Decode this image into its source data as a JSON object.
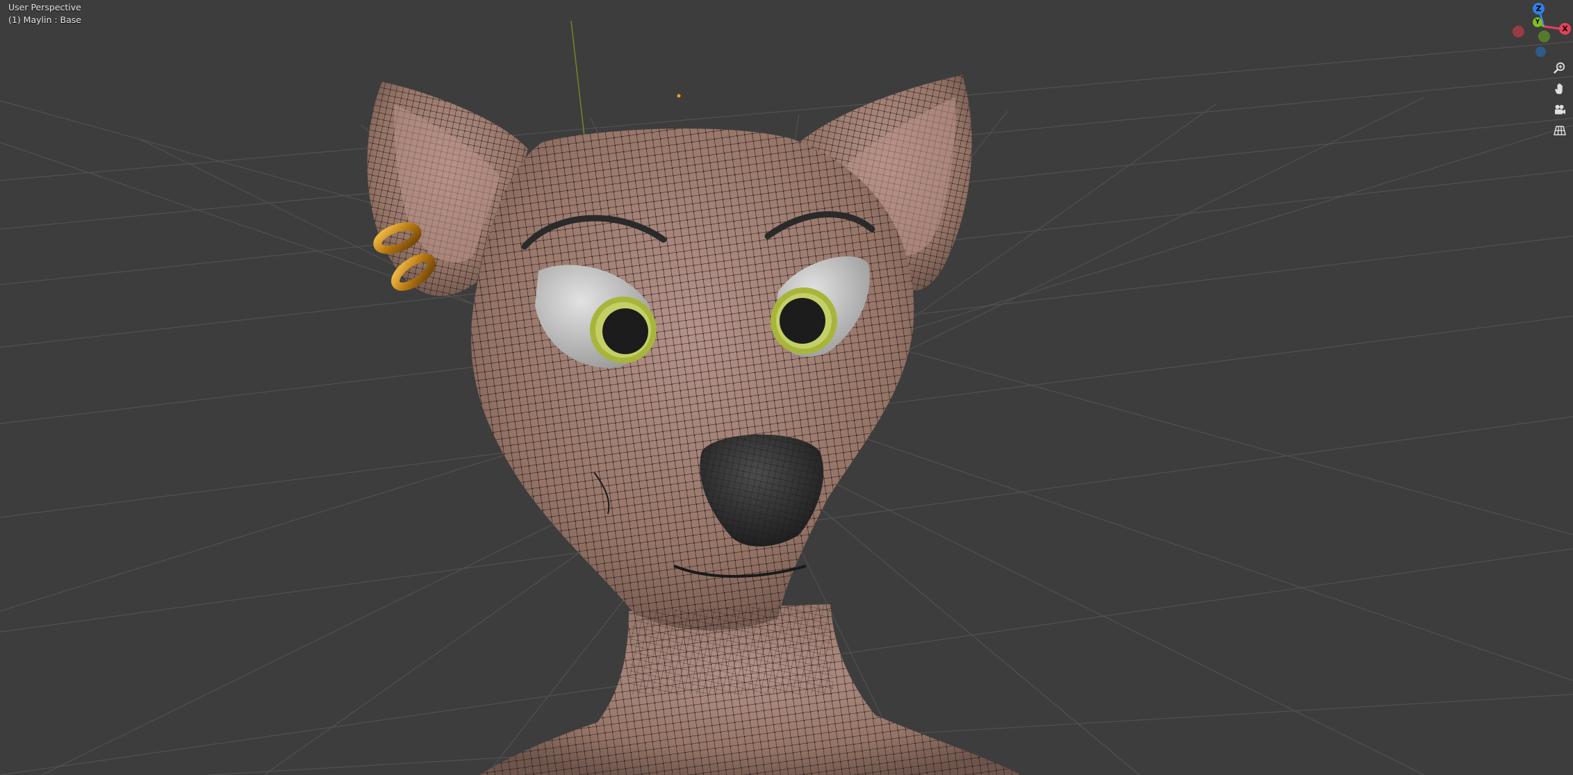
{
  "viewport": {
    "title": "User Perspective",
    "object_label": "(1) Maylin : Base"
  },
  "gizmo": {
    "axes": [
      {
        "label": "Z",
        "color": "#2f7fe6"
      },
      {
        "label": "Y",
        "color": "#7fbf22"
      },
      {
        "label": "X",
        "color": "#e8405a"
      }
    ],
    "negative_axes": [
      {
        "name": "-x",
        "color": "#9a3a45"
      },
      {
        "name": "-y",
        "color": "#567a2c"
      },
      {
        "name": "-z",
        "color": "#2e5a8c"
      }
    ]
  },
  "nav_buttons": [
    {
      "name": "zoom-icon",
      "tooltip": "Zoom"
    },
    {
      "name": "hand-pan-icon",
      "tooltip": "Move"
    },
    {
      "name": "camera-view-icon",
      "tooltip": "Camera"
    },
    {
      "name": "grid-ortho-icon",
      "tooltip": "Orthographic"
    }
  ],
  "colors": {
    "background": "#3d3d3d",
    "grid": "#535353",
    "skin": "#9a7a6e",
    "wire": "#111111",
    "eye_white": "#c8c8c8",
    "iris": "#a7b63a",
    "pupil": "#1c1c1c",
    "nose": "#333333",
    "ring": "#c8891a",
    "origin_dot": "#ff9a18"
  }
}
